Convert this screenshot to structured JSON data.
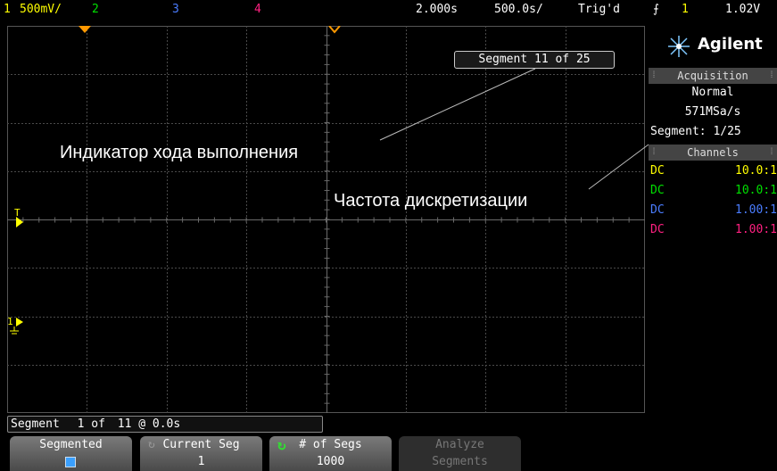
{
  "topbar": {
    "ch1_num": "1",
    "ch1_scale": "500mV/",
    "ch2_num": "2",
    "ch3_num": "3",
    "ch4_num": "4",
    "delay": "2.000s",
    "timebase": "500.0s/",
    "trig_status": "Trig'd",
    "trig_icon": "rising-edge-icon",
    "trig_src": "1",
    "trig_level": "1.02V"
  },
  "segment_box": {
    "label": "Segment 11 of 25"
  },
  "annotations": {
    "progress": "Индикатор хода выполнения",
    "sample_rate": "Частота дискретизации"
  },
  "panel": {
    "brand": "Agilent",
    "acq_header": "Acquisition",
    "mode": "Normal",
    "rate": "571MSa/s",
    "segment": "Segment: 1/25",
    "channels_header": "Channels",
    "channels": [
      {
        "coupling": "DC",
        "atten": "10.0:1",
        "color": "#ffff00"
      },
      {
        "coupling": "DC",
        "atten": "10.0:1",
        "color": "#00e000"
      },
      {
        "coupling": "DC",
        "atten": "1.00:1",
        "color": "#4a7dff"
      },
      {
        "coupling": "DC",
        "atten": "1.00:1",
        "color": "#ff2080"
      }
    ]
  },
  "markers": {
    "trigger_level": "T",
    "ground_ch1": "1"
  },
  "status": {
    "segment_word": "Segment",
    "seg_num": "1",
    "of_word": "of",
    "seg_total": "11",
    "at_time": "@ 0.0s"
  },
  "softkeys": [
    {
      "label": "Segmented",
      "value": ""
    },
    {
      "label": "Current Seg",
      "value": "1"
    },
    {
      "label": "# of Segs",
      "value": "1000"
    },
    {
      "label": "Analyze",
      "value": "Segments"
    }
  ],
  "colors": {
    "ch1": "#ffff00",
    "ch2": "#00e000",
    "ch3": "#4a7dff",
    "ch4": "#ff2080",
    "marker_orange": "#ff9900",
    "grid": "#4a4a4a"
  }
}
